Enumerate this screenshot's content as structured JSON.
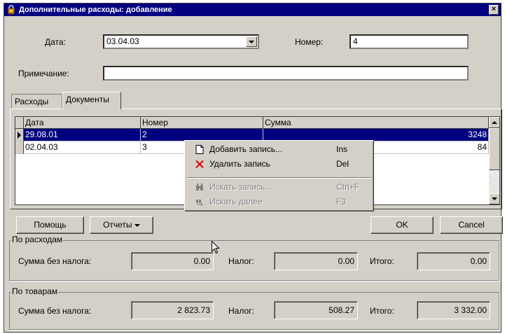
{
  "window": {
    "title": "Дополнительные расходы: добавление",
    "close_label": "×"
  },
  "form": {
    "date_label": "Дата:",
    "date_value": "03.04.03",
    "number_label": "Номер:",
    "number_value": "4",
    "note_label": "Примечание:",
    "note_value": ""
  },
  "tabs": [
    {
      "label": "Расходы",
      "active": false
    },
    {
      "label": "Документы",
      "active": true
    }
  ],
  "grid": {
    "columns": [
      "Дата",
      "Номер",
      "Сумма"
    ],
    "rows": [
      {
        "date": "29.08.01",
        "number": "2",
        "sum": "3248",
        "selected": true
      },
      {
        "date": "02.04.03",
        "number": "3",
        "sum": "84",
        "selected": false
      }
    ]
  },
  "context_menu": {
    "items": [
      {
        "label": "Добавить запись...",
        "shortcut": "Ins",
        "icon": "new-document-icon",
        "enabled": true
      },
      {
        "label": "Удалить запись",
        "shortcut": "Del",
        "icon": "delete-x-icon",
        "enabled": true
      },
      {
        "label": "Искать запись...",
        "shortcut": "Ctrl+F",
        "icon": "binoculars-icon",
        "enabled": false
      },
      {
        "label": "Искать далее",
        "shortcut": "F3",
        "icon": "find-next-icon",
        "enabled": false
      }
    ]
  },
  "buttons": {
    "help": "Помощь",
    "reports": "Отчеты",
    "ok": "OK",
    "cancel": "Cancel"
  },
  "expenses_group": {
    "title": "По расходам",
    "sum_label": "Сумма без налога:",
    "sum_value": "0.00",
    "tax_label": "Налог:",
    "tax_value": "0.00",
    "total_label": "Итого:",
    "total_value": "0.00"
  },
  "goods_group": {
    "title": "По товарам",
    "sum_label": "Сумма без налога:",
    "sum_value": "2 823.73",
    "tax_label": "Налог:",
    "tax_value": "508.27",
    "total_label": "Итого:",
    "total_value": "3 332.00"
  },
  "colors": {
    "window_bg": "#d4d0c8",
    "titlebar": "#000080",
    "selection": "#000080",
    "delete_icon": "#e00000"
  }
}
